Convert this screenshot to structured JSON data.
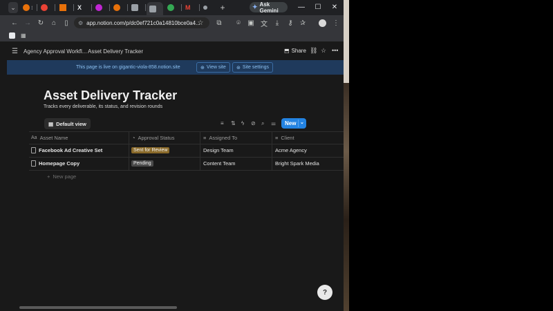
{
  "browser": {
    "tabs": [
      {
        "color": "#e8710a"
      },
      {
        "color": "#e94235"
      },
      {
        "color": "#e8710a"
      },
      {
        "glyph": "X"
      },
      {
        "color": "#c026d3"
      },
      {
        "color": "#e8710a"
      },
      {
        "color": "#9aa0a6"
      },
      {
        "color": "#9aa0a6"
      },
      {
        "color": "#34a853",
        "glyph": "S"
      },
      {
        "glyph": "M"
      },
      {
        "color": "#9aa0a6"
      }
    ],
    "gemini_label": "Ask Gemini",
    "url": "app.notion.com/p/dc0ef721c0a14810bce0a4...",
    "new_tab_symbol": "+"
  },
  "notion": {
    "breadcrumb": [
      "Agency Approval Workfl...",
      "Asset Delivery Tracker"
    ],
    "share_label": "Share",
    "banner": {
      "message": "This page is live on gigantic-viola-858.notion.site",
      "view_site": "View site",
      "site_settings": "Site settings"
    },
    "title": "Asset Delivery Tracker",
    "description": "Tracks every deliverable, its status, and revision rounds",
    "view_name": "Default view",
    "new_button": "New",
    "columns": [
      "Asset Name",
      "Approval Status",
      "Assigned To",
      "Client"
    ],
    "rows": [
      {
        "name": "Facebook Ad Creative Set",
        "status": "Sent for Review",
        "status_color": "#8a6a2a",
        "assigned": "Design Team",
        "client": "Acme Agency"
      },
      {
        "name": "Homepage Copy",
        "status": "Pending",
        "status_color": "#4a4a4a",
        "assigned": "Content Team",
        "client": "Bright Spark Media"
      }
    ],
    "new_page": "New page",
    "help": "?"
  }
}
